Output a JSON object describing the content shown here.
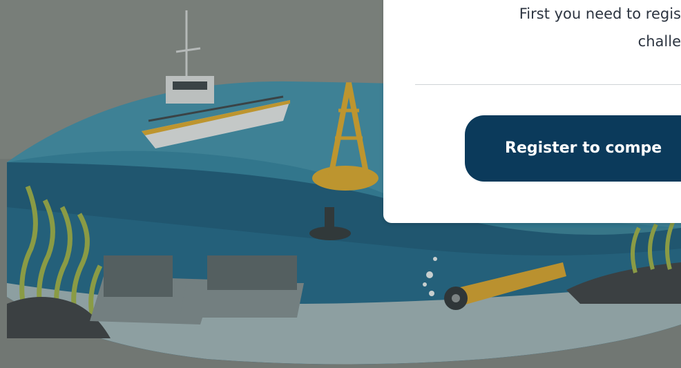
{
  "background": {
    "illustration": "ocean-cross-section-illustration",
    "colors": {
      "sky": "#8a8f88",
      "water_surface": "#3f8fa6",
      "deep_water": "#154e6b",
      "sea_floor": "#9bb1b3",
      "buoy": "#d9a62a",
      "boat_hull": "#e2e4e3",
      "seaweed": "#9bae45"
    }
  },
  "modal": {
    "intro_line1": "First you need to regis",
    "intro_line2": "challe",
    "register_button_label": "Register to compe"
  },
  "theme": {
    "button_color": "#0b3a5b",
    "modal_bg": "#ffffff",
    "text_color": "#2c3440"
  }
}
